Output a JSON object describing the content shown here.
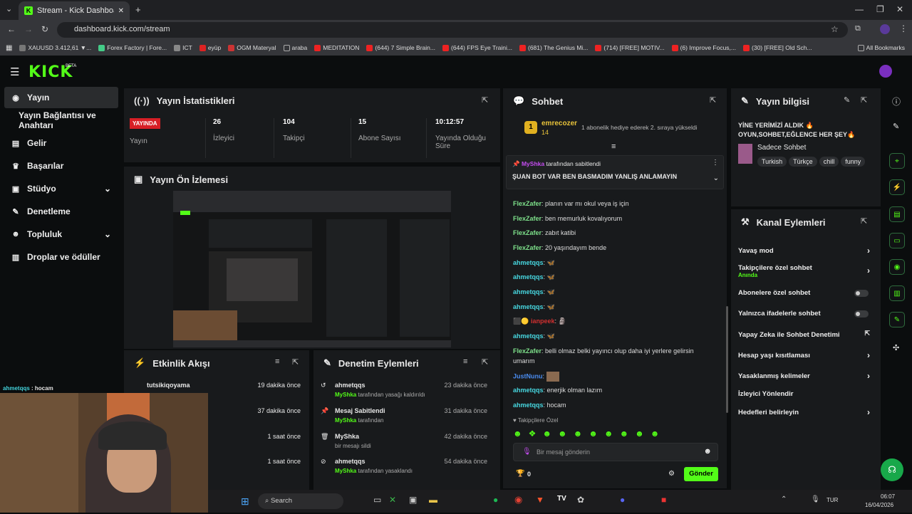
{
  "browser": {
    "tab_title": "Stream - Kick Dashboard",
    "url": "dashboard.kick.com/stream",
    "bookmarks": [
      "XAUUSD 3.412,61 ▼...",
      "Forex Factory | Fore...",
      "ICT",
      "eyüp",
      "OGM Materyal",
      "araba",
      "MEDITATION",
      "(644) 7 Simple Brain...",
      "(644) FPS Eye Traini...",
      "(681) The Genius Mi...",
      "(714) [FREE] MOTIV...",
      "(6) Improve Focus,...",
      "(30) [FREE] Old Sch...",
      "All Bookmarks"
    ]
  },
  "brand": {
    "logo": "KICK",
    "beta": "BETA",
    "accent": "#53fc18"
  },
  "sidebar": {
    "items": [
      {
        "label": "Yayın",
        "icon": "broadcast-icon"
      },
      {
        "label": "Yayın Bağlantısı ve Anahtarı"
      },
      {
        "label": "Gelir",
        "icon": "chart-icon"
      },
      {
        "label": "Başarılar",
        "icon": "trophy-icon"
      },
      {
        "label": "Stüdyo",
        "icon": "studio-icon"
      },
      {
        "label": "Denetleme",
        "icon": "wrench-icon"
      },
      {
        "label": "Topluluk",
        "icon": "people-icon"
      },
      {
        "label": "Droplar ve ödüller",
        "icon": "gift-icon"
      }
    ]
  },
  "stats": {
    "title": "Yayın İstatistikleri",
    "badge": "YAYINDA",
    "live_label": "Yayın",
    "items": [
      {
        "value": "26",
        "label": "İzleyici"
      },
      {
        "value": "104",
        "label": "Takipçi"
      },
      {
        "value": "15",
        "label": "Abone Sayısı"
      },
      {
        "value": "10:12:57",
        "label": "Yayında Olduğu Süre"
      }
    ]
  },
  "preview": {
    "title": "Yayın Ön İzlemesi"
  },
  "activity": {
    "title": "Etkinlik Akışı",
    "items": [
      {
        "user": "tutsikiqoyama",
        "time": "19 dakika önce"
      },
      {
        "user": "",
        "time": "37 dakika önce"
      },
      {
        "user": "",
        "time": "1 saat önce"
      },
      {
        "user": "",
        "time": "1 saat önce"
      }
    ]
  },
  "moderation": {
    "title": "Denetim Eylemleri",
    "items": [
      {
        "title": "ahmetqqs",
        "by": "MyShka",
        "desc": "tarafından yasağı kaldırıldı",
        "time": "23 dakika önce"
      },
      {
        "title": "Mesaj Sabitlendi",
        "by": "MyShka",
        "desc": "tarafından",
        "time": "31 dakika önce"
      },
      {
        "title": "MyShka",
        "by": "",
        "desc": "bir mesajı sildi",
        "time": "42 dakika önce"
      },
      {
        "title": "ahmetqqs",
        "by": "MyShka",
        "desc": "tarafından yasaklandı",
        "time": "54 dakika önce"
      }
    ]
  },
  "chat": {
    "title": "Sohbet",
    "gift_user": "emrecozer",
    "gift_count": "14",
    "gift_text": "1 abonelik hediye ederek 2. sıraya yükseldi",
    "pinned_by": "MyShka",
    "pinned_suffix": "tarafından sabitlendi",
    "pinned_text": "ŞUAN BOT VAR BEN BASMADIM YANLIŞ ANLAMAYIN",
    "messages": [
      {
        "user": "FlexZafer",
        "text": "planın var mı okul veya iş için"
      },
      {
        "user": "FlexZafer",
        "text": "ben memurluk kovalıyorum"
      },
      {
        "user": "FlexZafer",
        "text": "zabıt katibi"
      },
      {
        "user": "FlexZafer",
        "text": "20 yaşındayım bende"
      },
      {
        "user": "ahmetqqs",
        "text": "🦋"
      },
      {
        "user": "ahmetqqs",
        "text": "🦋"
      },
      {
        "user": "ahmetqqs",
        "text": "🦋"
      },
      {
        "user": "ahmetqqs",
        "text": "🦋"
      },
      {
        "user": "ianpeek",
        "text": "🗿"
      },
      {
        "user": "ahmetqqs",
        "text": "🦋"
      },
      {
        "user": "FlexZafer",
        "text": "belli olmaz belki yayıncı olup daha iyi yerlere gelirsin"
      },
      {
        "user": "",
        "text": "umarım"
      },
      {
        "user": "JustNunu",
        "text": ""
      },
      {
        "user": "ahmetqqs",
        "text": "enerjik olman lazım"
      },
      {
        "user": "ahmetqqs",
        "text": "hocam"
      }
    ],
    "followers_only": "Takipçilere Özel",
    "placeholder": "Bir mesaj gönderin",
    "count": "0",
    "send": "Gönder"
  },
  "info": {
    "title": "Yayın bilgisi",
    "stream_title": "YİNE YERİMİZİ ALDIK 🔥 OYUN,SOHBET,EĞLENCE HER ŞEY🔥",
    "category": "Sadece Sohbet",
    "tags": [
      "Turkish",
      "Türkçe",
      "chill",
      "funny"
    ]
  },
  "actions": {
    "title": "Kanal Eylemleri",
    "items": [
      {
        "label": "Yavaş mod",
        "type": "chevron"
      },
      {
        "label": "Takipçilere özel sohbet",
        "sub": "Anında",
        "type": "chevron"
      },
      {
        "label": "Abonelere özel sohbet",
        "type": "toggle"
      },
      {
        "label": "Yalnızca ifadelerle sohbet",
        "type": "toggle"
      },
      {
        "label": "Yapay Zeka ile Sohbet Denetimi",
        "type": "external"
      },
      {
        "label": "Hesap yaşı kısıtlaması",
        "type": "chevron"
      },
      {
        "label": "Yasaklanmış kelimeler",
        "type": "chevron"
      },
      {
        "label": "İzleyici Yönlendir",
        "type": "none"
      },
      {
        "label": "Hedefleri belirleyin",
        "type": "chevron"
      }
    ]
  },
  "webcam": {
    "overlay_user": "ahmetqqs",
    "overlay_text": "hocam"
  },
  "taskbar": {
    "search": "Search",
    "lang": "TUR",
    "time": "06:07",
    "date": "16/04/2026"
  }
}
